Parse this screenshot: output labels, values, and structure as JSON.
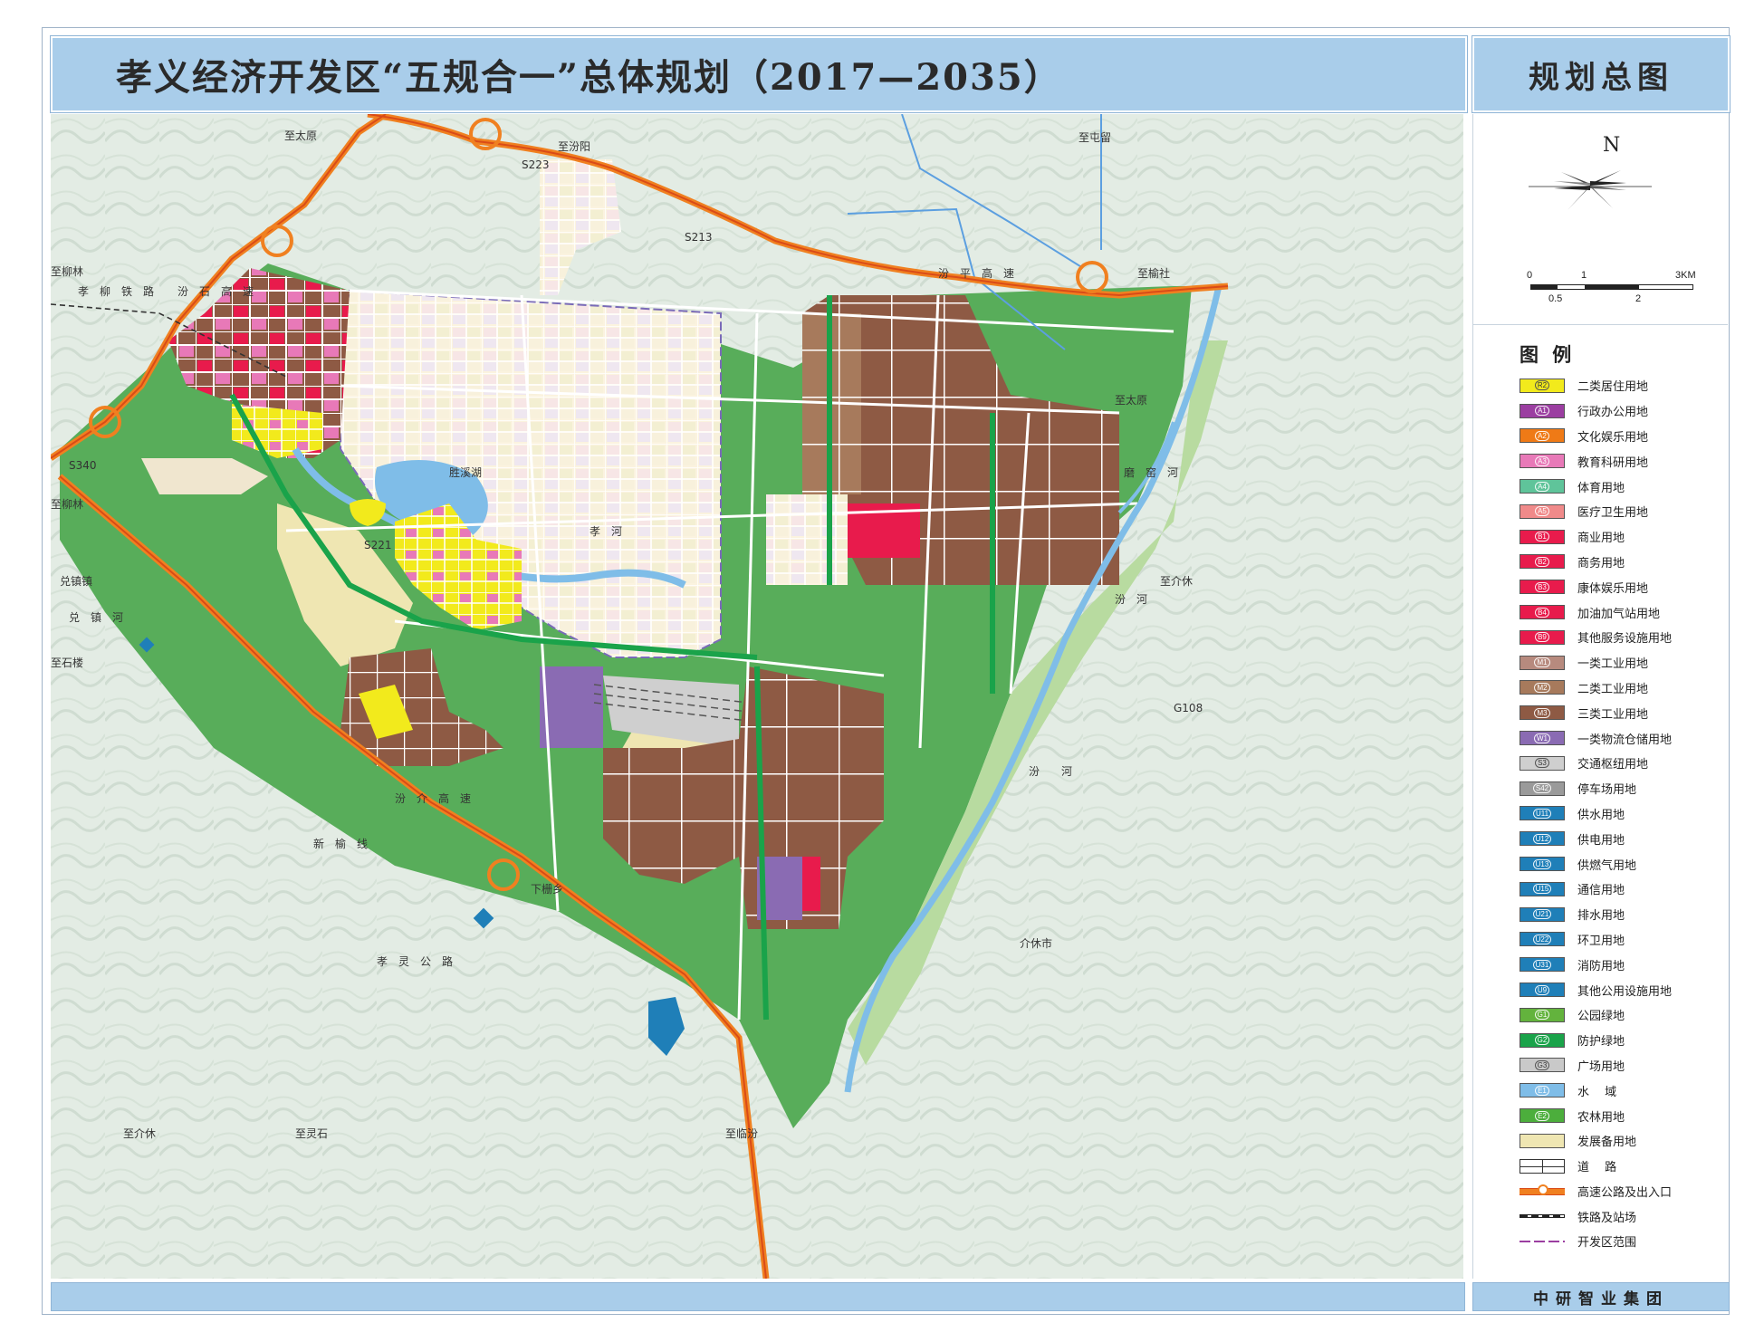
{
  "header": {
    "title": "孝义经济开发区“五规合一”总体规划（2017—2035）",
    "panel_title": "规划总图"
  },
  "compass": {
    "north_label": "N"
  },
  "scale": {
    "labels_top": [
      "0",
      "1",
      "3KM"
    ],
    "labels_bottom": [
      "0.5",
      "2"
    ]
  },
  "legend": {
    "title": "图 例",
    "items": [
      {
        "code": "R2",
        "label": "二类居住用地",
        "color": "#f2ea1c",
        "dark": true
      },
      {
        "code": "A1",
        "label": "行政办公用地",
        "color": "#9b3ea1"
      },
      {
        "code": "A2",
        "label": "文化娱乐用地",
        "color": "#ef7a16"
      },
      {
        "code": "A3",
        "label": "教育科研用地",
        "color": "#e879b8"
      },
      {
        "code": "A4",
        "label": "体育用地",
        "color": "#5fc49a"
      },
      {
        "code": "A5",
        "label": "医疗卫生用地",
        "color": "#f08a8a"
      },
      {
        "code": "B1",
        "label": "商业用地",
        "color": "#e81b4c"
      },
      {
        "code": "B2",
        "label": "商务用地",
        "color": "#e81b4c"
      },
      {
        "code": "B3",
        "label": "康体娱乐用地",
        "color": "#e81b4c"
      },
      {
        "code": "B4",
        "label": "加油加气站用地",
        "color": "#e81b4c"
      },
      {
        "code": "B9",
        "label": "其他服务设施用地",
        "color": "#e81b4c"
      },
      {
        "code": "M1",
        "label": "一类工业用地",
        "color": "#b78a7e"
      },
      {
        "code": "M2",
        "label": "二类工业用地",
        "color": "#a77a5c"
      },
      {
        "code": "M3",
        "label": "三类工业用地",
        "color": "#8e5a44"
      },
      {
        "code": "W1",
        "label": "一类物流仓储用地",
        "color": "#8a6bb3"
      },
      {
        "code": "S3",
        "label": "交通枢纽用地",
        "color": "#cfcfcf",
        "dark": true
      },
      {
        "code": "S42",
        "label": "停车场用地",
        "color": "#9a9a9a"
      },
      {
        "code": "U11",
        "label": "供水用地",
        "color": "#1f7fb8"
      },
      {
        "code": "U12",
        "label": "供电用地",
        "color": "#1f7fb8"
      },
      {
        "code": "U13",
        "label": "供燃气用地",
        "color": "#1f7fb8"
      },
      {
        "code": "U15",
        "label": "通信用地",
        "color": "#1f7fb8"
      },
      {
        "code": "U21",
        "label": "排水用地",
        "color": "#1f7fb8"
      },
      {
        "code": "U22",
        "label": "环卫用地",
        "color": "#1f7fb8"
      },
      {
        "code": "U31",
        "label": "消防用地",
        "color": "#1f7fb8"
      },
      {
        "code": "U9",
        "label": "其他公用设施用地",
        "color": "#1f7fb8"
      },
      {
        "code": "G1",
        "label": "公园绿地",
        "color": "#63b33d"
      },
      {
        "code": "G2",
        "label": "防护绿地",
        "color": "#1aa34a"
      },
      {
        "code": "G3",
        "label": "广场用地",
        "color": "#c9c9c9",
        "dark": true
      },
      {
        "code": "E1",
        "label": "水　 域",
        "color": "#7fbde8"
      },
      {
        "code": "E2",
        "label": "农林用地",
        "color": "#4cae3c"
      },
      {
        "code": "",
        "label": "发展备用地",
        "color": "#efe6b2"
      },
      {
        "code": "",
        "label": "道　 路",
        "color": "#ffffff",
        "pattern": "road"
      },
      {
        "code": "",
        "label": "高速公路及出入口",
        "color": "#ffffff",
        "pattern": "highway"
      },
      {
        "code": "",
        "label": "铁路及站场",
        "color": "#ffffff",
        "pattern": "rail"
      },
      {
        "code": "",
        "label": "开发区范围",
        "color": "#ffffff",
        "pattern": "boundary"
      }
    ]
  },
  "map_labels": {
    "to_taiyuan_1": "至太原",
    "to_taiyuan_2": "至太原",
    "to_liulin_1": "至柳林",
    "to_liulin_2": "至柳林",
    "to_yushe": "至榆社",
    "to_tunliu": "至屯留",
    "s223": "S223",
    "to_fenyang": "至汾阳",
    "s213": "S213",
    "s340": "S340",
    "s221": "S221",
    "g108": "G108",
    "fenping_expressway": "汾　平　高　速",
    "fenshi_expressway": "汾　石　高　速",
    "xiaoliu_railway": "孝　柳　铁　路",
    "fenjie_expressway": "汾　介　高　速",
    "dui_zhen": "兑镇镇",
    "dui_river": "兑　镇　河",
    "xinyu_line": "新　榆　线",
    "xiaoling_road": "孝　灵　公　路",
    "xiashan_river": "下栅乡",
    "jiexiu": "介休市",
    "fen_river": "汾　　河",
    "shengxi_lake": "胜溪湖",
    "to_shilou": "至石楼",
    "to_lingshi": "至灵石",
    "to_jieziu2": "至介休",
    "to_linfen": "至临汾",
    "mo_river": "磨　窑　河",
    "xiaohe": "孝　河",
    "fenhe_east": "汾　河",
    "to_jiexiu_top": "至介休"
  },
  "footer": {
    "org": "中研智业集团"
  }
}
